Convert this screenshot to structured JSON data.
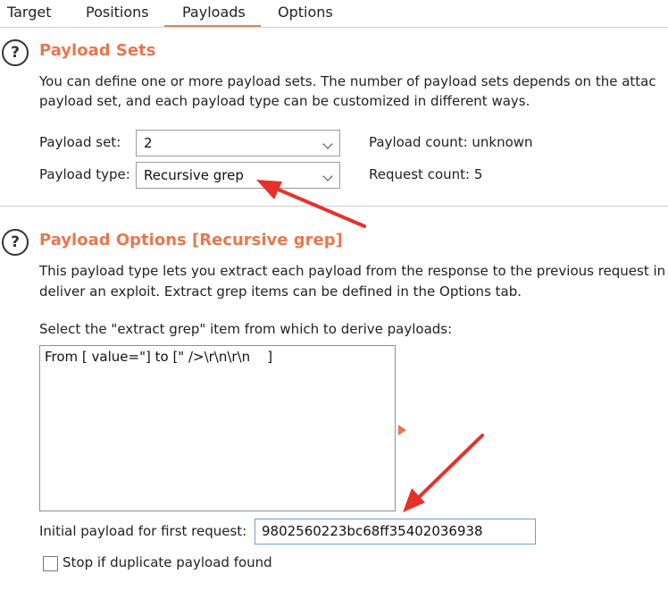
{
  "tabs": [
    {
      "label": "Target"
    },
    {
      "label": "Positions"
    },
    {
      "label": "Payloads"
    },
    {
      "label": "Options"
    }
  ],
  "active_tab": "Payloads",
  "accent_color": "#e8774d",
  "help_icon": "?",
  "payload_sets": {
    "title": "Payload Sets",
    "description_line1": "You can define one or more payload sets. The number of payload sets depends on the attac",
    "description_line2": "payload set, and each payload type can be customized in different ways.",
    "payload_set_label": "Payload set:",
    "payload_set_value": "2",
    "payload_type_label": "Payload type:",
    "payload_type_value": "Recursive grep",
    "payload_count": "Payload count: unknown",
    "request_count": "Request count: 5"
  },
  "payload_options": {
    "title": "Payload Options [Recursive grep]",
    "description_line1": "This payload type lets you extract each payload from the response to the previous request in",
    "description_line2": "deliver an exploit. Extract grep items can be defined in the Options tab.",
    "select_label": "Select the \"extract grep\" item from which to derive payloads:",
    "items": [
      "From [ value=\"] to [\" />\\r\\n\\r\\n    ]"
    ],
    "initial_payload_label": "Initial payload for first request:",
    "initial_payload_value": "9802560223bc68ff35402036938",
    "stop_duplicate_label": "Stop if duplicate payload found",
    "stop_duplicate_checked": false
  }
}
